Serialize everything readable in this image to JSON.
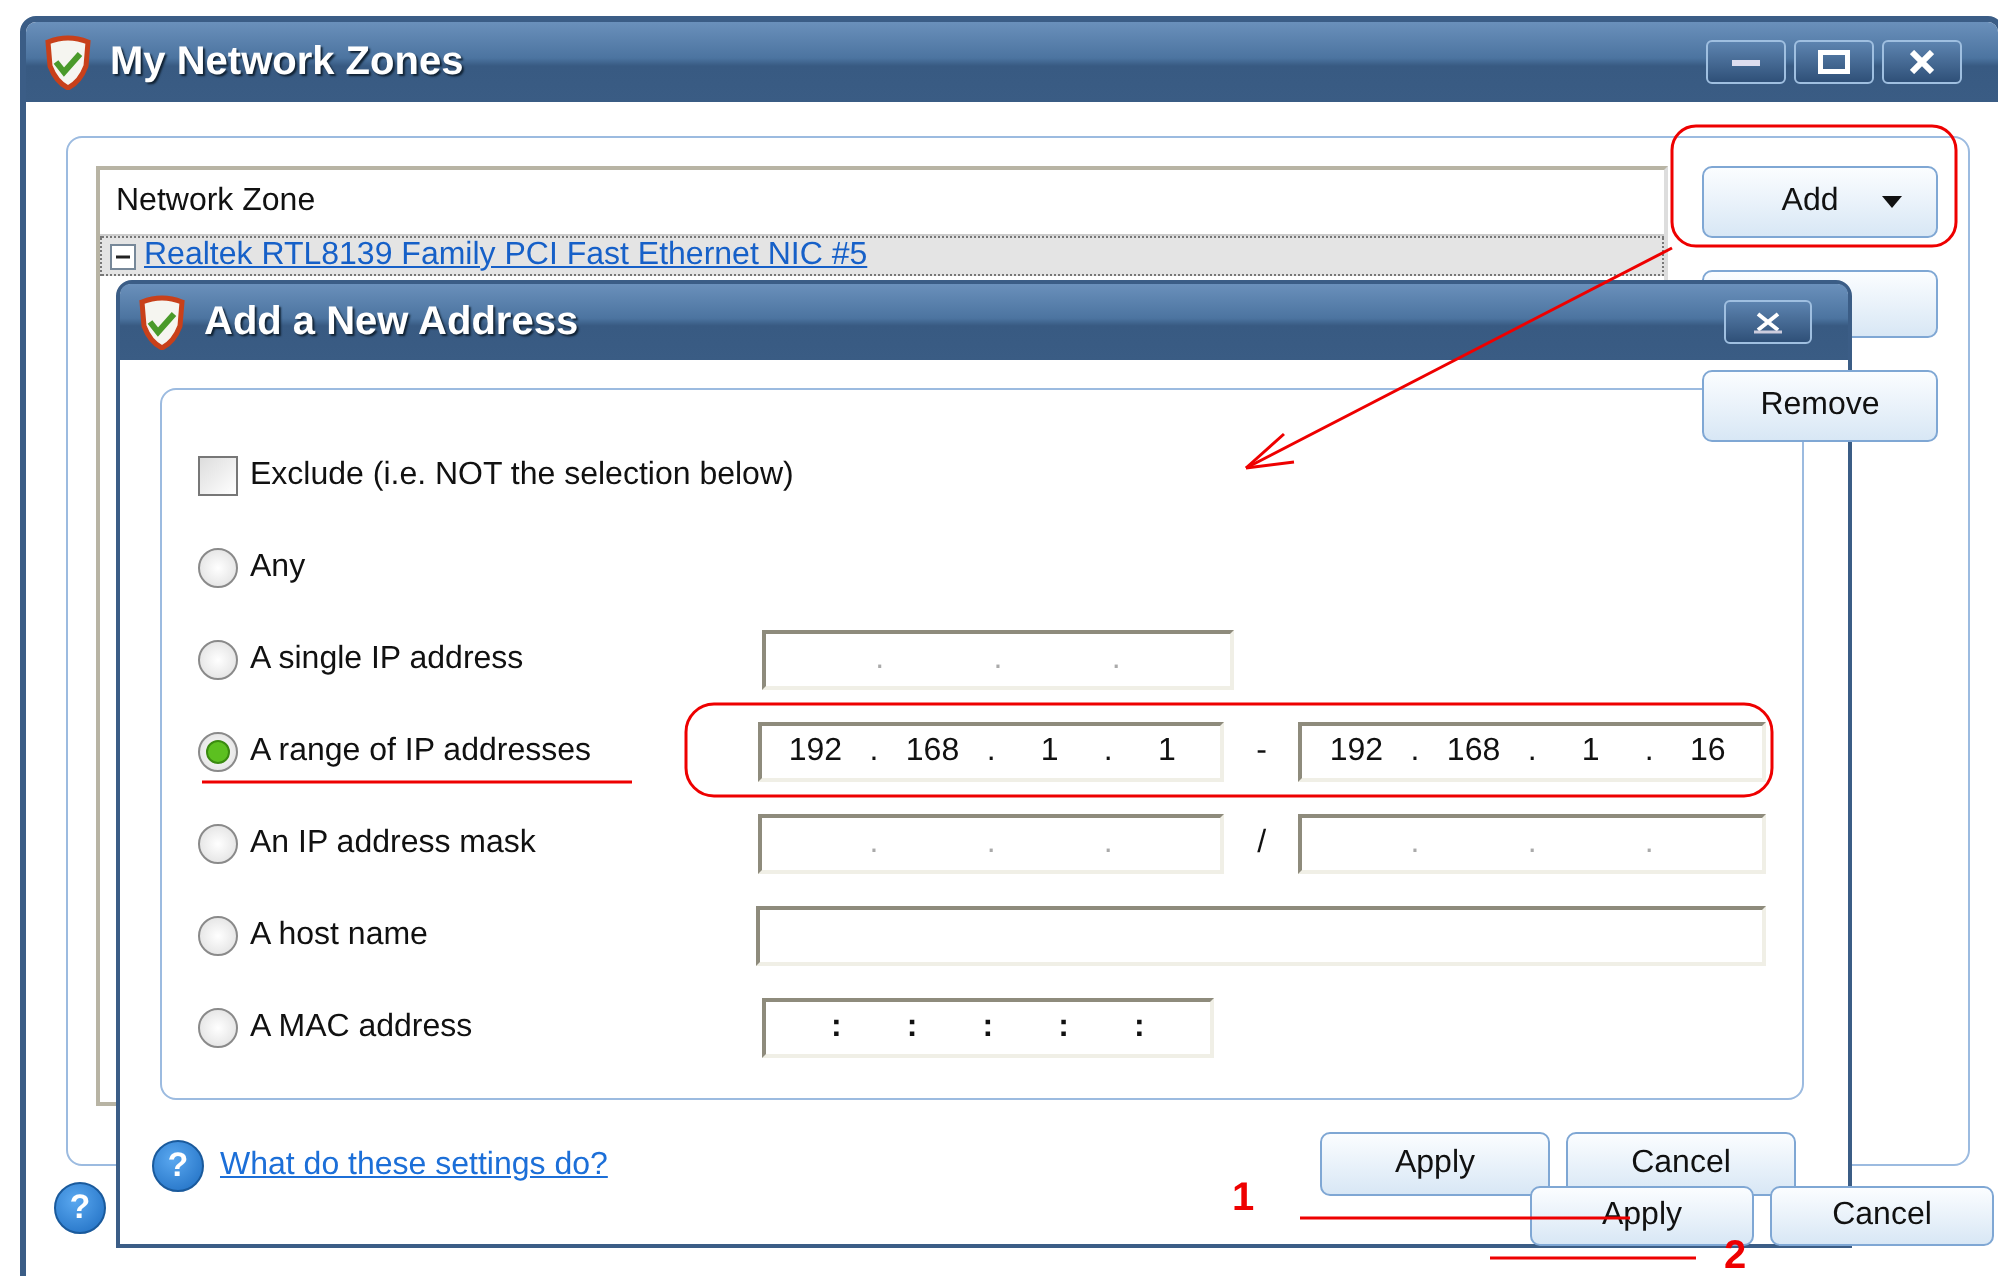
{
  "main_window": {
    "title": "My Network Zones",
    "list": {
      "header": "Network Zone",
      "items": [
        {
          "label": "Realtek RTL8139 Family PCI Fast Ethernet NIC #5",
          "expanded": true
        }
      ]
    },
    "side_buttons": [
      {
        "label": "Add",
        "kind": "dropdown"
      },
      {
        "label": "Remove",
        "kind": "plain"
      }
    ],
    "footer_buttons": [
      {
        "label": "Apply"
      },
      {
        "label": "Cancel"
      }
    ],
    "help_icon": "?"
  },
  "dialog": {
    "title": "Add a New Address",
    "exclude": {
      "label": "Exclude (i.e. NOT the selection below)",
      "checked": false
    },
    "options": [
      {
        "label": "Any",
        "selected": false,
        "kind": "none"
      },
      {
        "label": "A single IP address",
        "selected": false,
        "kind": "single",
        "fields": [
          {
            "kind": "ipv4",
            "separator": "."
          }
        ]
      },
      {
        "label": "A range of IP addresses",
        "selected": true,
        "kind": "pair",
        "joiner": "-",
        "fields": [
          {
            "kind": "ipv4",
            "separator": ".",
            "octets": [
              "192",
              "168",
              "1",
              "1"
            ]
          },
          {
            "kind": "ipv4",
            "separator": ".",
            "octets": [
              "192",
              "168",
              "1",
              "16"
            ]
          }
        ]
      },
      {
        "label": "An IP address mask",
        "selected": false,
        "kind": "pair",
        "joiner": "/",
        "fields": [
          {
            "kind": "ipv4",
            "separator": "."
          },
          {
            "kind": "ipv4",
            "separator": "."
          }
        ]
      },
      {
        "label": "A host name",
        "selected": false,
        "kind": "single",
        "fields": [
          {
            "kind": "text"
          }
        ]
      },
      {
        "label": "A MAC address",
        "selected": false,
        "kind": "single",
        "fields": [
          {
            "kind": "mac",
            "separator": ":"
          }
        ]
      }
    ],
    "help_icon": "?",
    "help_link": "What do these settings do?",
    "buttons": [
      {
        "label": "Apply"
      },
      {
        "label": "Cancel"
      }
    ]
  },
  "annotations": {
    "labels": [
      "1",
      "2"
    ]
  }
}
